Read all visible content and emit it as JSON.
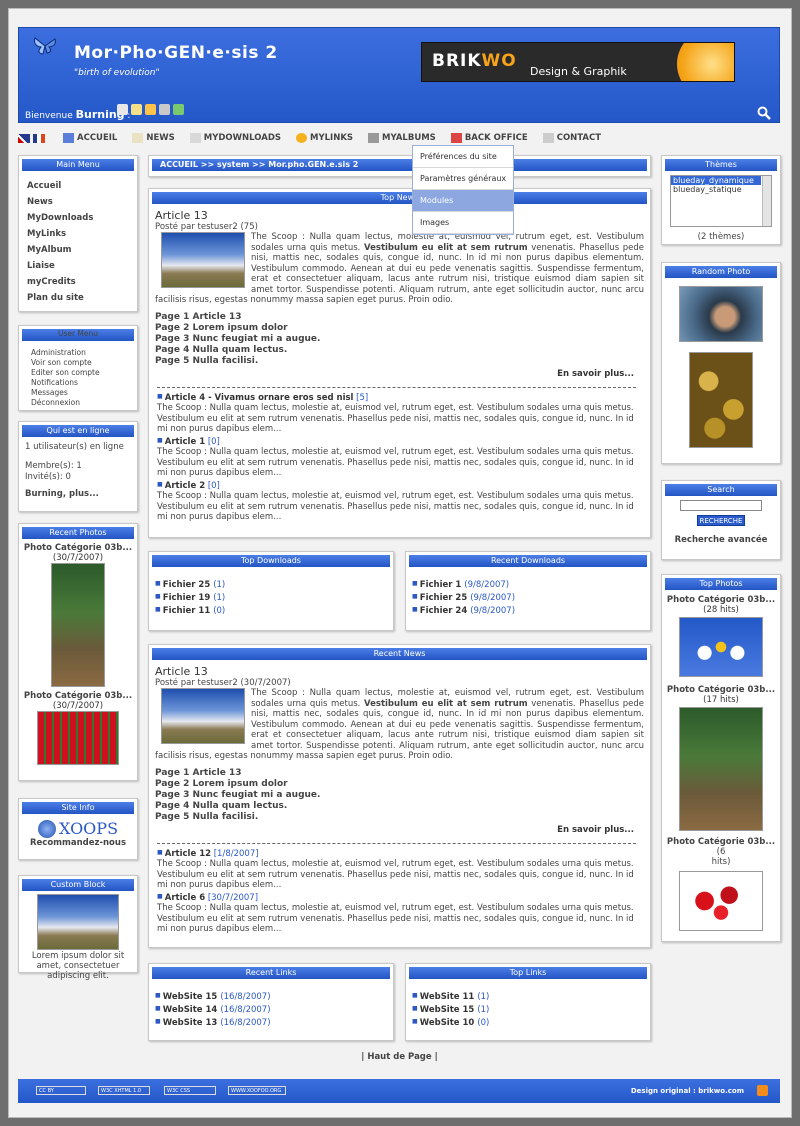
{
  "header": {
    "title": "Mor·Pho·GEN·e·sis 2",
    "slogan": "\"birth of evolution\"",
    "welcome": "Bienvenue",
    "username": "Burning",
    "banner_brand_a": "BRIK",
    "banner_brand_b": "WO",
    "banner_tagline": "Design & Graphik"
  },
  "nav": {
    "items": [
      "ACCUEIL",
      "NEWS",
      "MYDOWNLOADS",
      "MYLINKS",
      "MYALBUMS",
      "BACK OFFICE",
      "CONTACT"
    ],
    "dropdown": [
      "Préférences du site",
      "Paramètres généraux",
      "Modules",
      "Images"
    ]
  },
  "breadcrumb": "ACCUEIL >> system >> Mor.pho.GEN.e.sis 2",
  "main_menu": {
    "title": "Main Menu",
    "items": [
      "Accueil",
      "News",
      "MyDownloads",
      "MyLinks",
      "MyAlbum",
      "Liaise",
      "myCredits",
      "Plan du site"
    ]
  },
  "user_menu": {
    "title": "User Menu",
    "items": [
      "Administration",
      "Voir son compte",
      "Editer son compte",
      "Notifications",
      "Messages",
      "Déconnexion"
    ]
  },
  "online": {
    "title": "Qui est en ligne",
    "line1": "1 utilisateur(s) en ligne",
    "members": "Membre(s): 1",
    "guests": "Invité(s): 0",
    "more": "Burning, plus..."
  },
  "recent_photos": {
    "title": "Recent Photos",
    "photo1": "Photo Catégorie 03b...",
    "date1": "(30/7/2007)",
    "photo2": "Photo Catégorie 03b...",
    "date2": "(30/7/2007)"
  },
  "site_info": {
    "title": "Site Info",
    "logo_text": "XOOPS",
    "recommend": "Recommandez-nous"
  },
  "custom_block": {
    "title": "Custom Block",
    "text": "Lorem ipsum dolor sit amet, consectetuer adipiscing elit."
  },
  "themes": {
    "title": "Thèmes",
    "options": [
      "blueday_dynamique",
      "blueday_statique"
    ],
    "count": "(2 thèmes)"
  },
  "random_photo": {
    "title": "Random Photo"
  },
  "search": {
    "title": "Search",
    "button": "RECHERCHE",
    "advanced": "Recherche avancée"
  },
  "top_photos": {
    "title": "Top Photos",
    "p1": "Photo Catégorie 03b...",
    "h1": "(28 hits)",
    "p2": "Photo Catégorie 03b...",
    "h2": "(17 hits)",
    "p3": "Photo Catégorie 03b...",
    "h3a": "(6",
    "h3b": "hits)"
  },
  "top_news": {
    "title": "Top News",
    "article_title": "Article 13",
    "posted": "Posté par testuser2 (75)",
    "body_a": "The Scoop : Nulla quam lectus, molestie at, euismod vel, rutrum eget, est. Vestibulum sodales urna quis metus.",
    "body_bold": "Vestibulum eu elit at sem rutrum",
    "body_b": "venenatis. Phasellus pede nisi, mattis nec, sodales quis, congue id, nunc. In id mi non purus dapibus elementum. Vestibulum commodo. Aenean at dui eu pede venenatis sagittis. Suspendisse fermentum, erat et consectetuer aliquam, lacus ante rutrum nisi, tristique euismod diam sapien sit amet tortor. Suspendisse potenti. Aliquam rutrum, ante eget sollicitudin auctor, nunc arcu facilisis risus, egestas nonummy massa sapien eget purus. Proin odio.",
    "pages": [
      "Page 1 Article 13",
      "Page 2 Lorem ipsum dolor",
      "Page 3 Nunc feugiat mi a augue.",
      "Page 4 Nulla quam lectus.",
      "Page 5 Nulla facilisi."
    ],
    "readmore": "En savoir plus...",
    "items": [
      {
        "title": "Article 4 - Vivamus ornare eros sed nisl",
        "count": "[5]",
        "text": "The Scoop : Nulla quam lectus, molestie at, euismod vel, rutrum eget, est. Vestibulum sodales urna quis metus. Vestibulum eu elit at sem rutrum venenatis. Phasellus pede nisi, mattis nec, sodales quis, congue id, nunc. In id mi non purus dapibus elem..."
      },
      {
        "title": "Article 1",
        "count": "[0]",
        "text": "The Scoop : Nulla quam lectus, molestie at, euismod vel, rutrum eget, est. Vestibulum sodales urna quis metus. Vestibulum eu elit at sem rutrum venenatis. Phasellus pede nisi, mattis nec, sodales quis, congue id, nunc. In id mi non purus dapibus elem..."
      },
      {
        "title": "Article 2",
        "count": "[0]",
        "text": "The Scoop : Nulla quam lectus, molestie at, euismod vel, rutrum eget, est. Vestibulum sodales urna quis metus. Vestibulum eu elit at sem rutrum venenatis. Phasellus pede nisi, mattis nec, sodales quis, congue id, nunc. In id mi non purus dapibus elem..."
      }
    ]
  },
  "top_downloads": {
    "title": "Top Downloads",
    "items": [
      [
        "Fichier 25",
        "(1)"
      ],
      [
        "Fichier 19",
        "(1)"
      ],
      [
        "Fichier 11",
        "(0)"
      ]
    ]
  },
  "recent_downloads": {
    "title": "Recent Downloads",
    "items": [
      [
        "Fichier 1",
        "(9/8/2007)"
      ],
      [
        "Fichier 25",
        "(9/8/2007)"
      ],
      [
        "Fichier 24",
        "(9/8/2007)"
      ]
    ]
  },
  "recent_news": {
    "title": "Recent News",
    "article_title": "Article 13",
    "posted": "Posté par testuser2 (30/7/2007)",
    "items": [
      {
        "title": "Article 12",
        "count": "[1/8/2007]",
        "text": "The Scoop : Nulla quam lectus, molestie at, euismod vel, rutrum eget, est. Vestibulum sodales urna quis metus. Vestibulum eu elit at sem rutrum venenatis. Phasellus pede nisi, mattis nec, sodales quis, congue id, nunc. In id mi non purus dapibus elem..."
      },
      {
        "title": "Article 6",
        "count": "[30/7/2007]",
        "text": "The Scoop : Nulla quam lectus, molestie at, euismod vel, rutrum eget, est. Vestibulum sodales urna quis metus. Vestibulum eu elit at sem rutrum venenatis. Phasellus pede nisi, mattis nec, sodales quis, congue id, nunc. In id mi non purus dapibus elem..."
      }
    ]
  },
  "recent_links": {
    "title": "Recent Links",
    "items": [
      [
        "WebSite 15",
        "(16/8/2007)"
      ],
      [
        "WebSite 14",
        "(16/8/2007)"
      ],
      [
        "WebSite 13",
        "(16/8/2007)"
      ]
    ]
  },
  "top_links": {
    "title": "Top Links",
    "items": [
      [
        "WebSite 11",
        "(1)"
      ],
      [
        "WebSite 15",
        "(1)"
      ],
      [
        "WebSite 10",
        "(0)"
      ]
    ]
  },
  "back_to_top": "| Haut de Page |",
  "footer": {
    "badges": [
      "CC BY",
      "W3C XHTML 1.0",
      "W3C CSS",
      "WWW.XOOFOO.ORG"
    ],
    "credit": "Design original : brikwo.com"
  }
}
